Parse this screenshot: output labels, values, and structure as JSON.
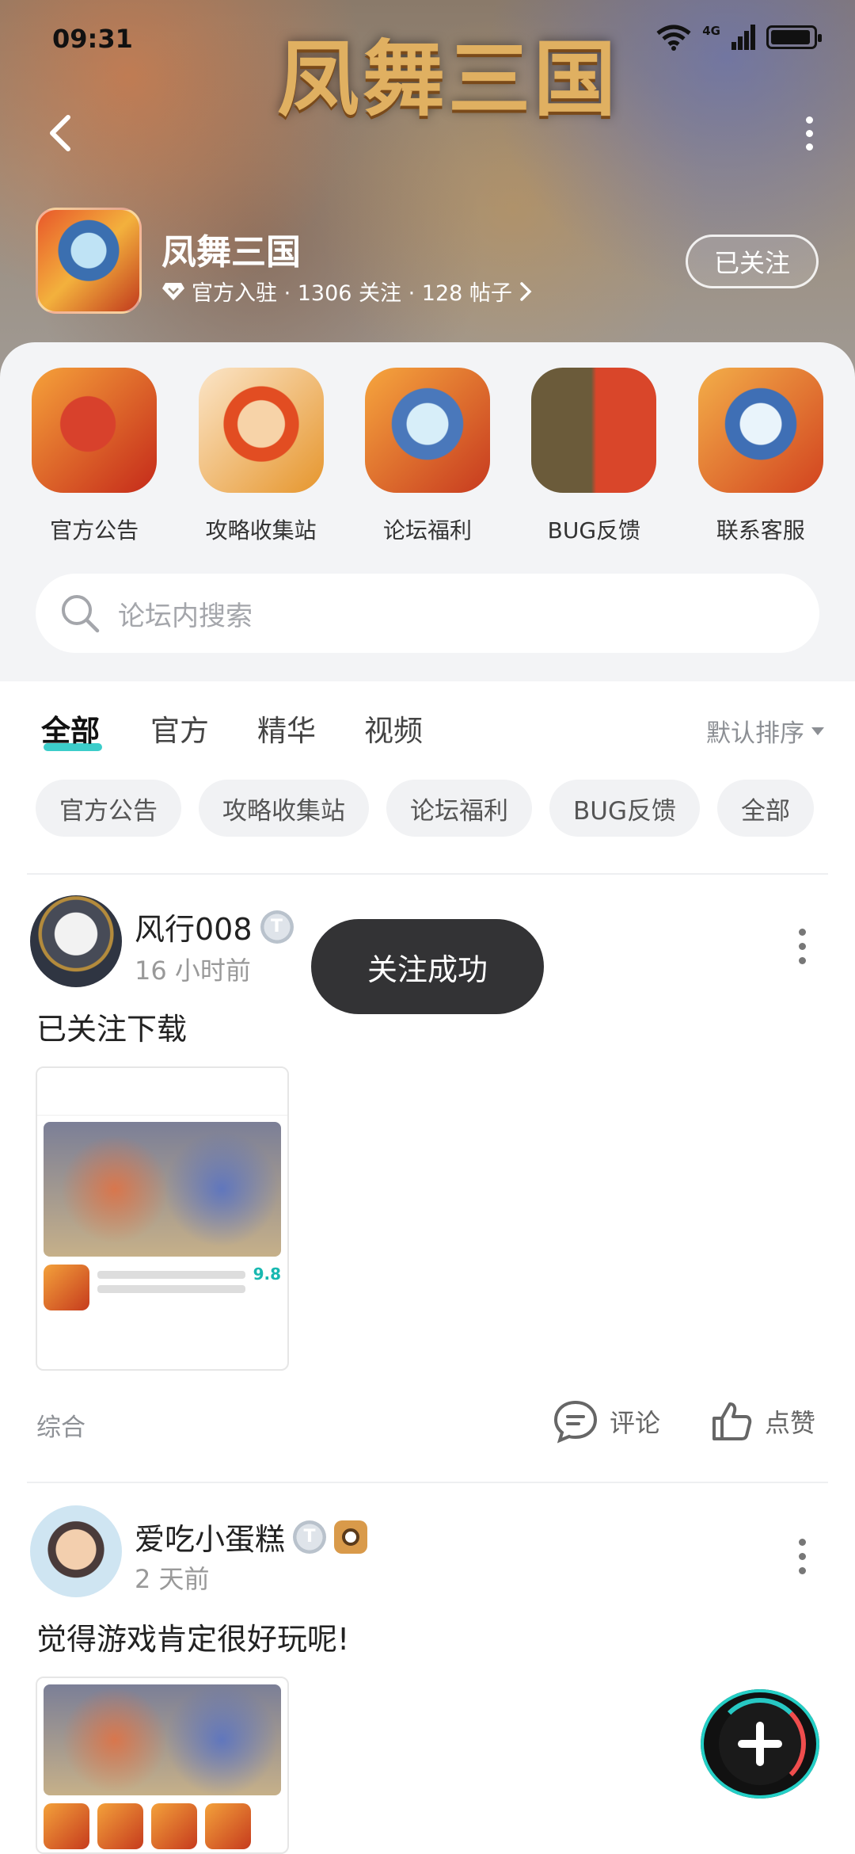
{
  "status_bar": {
    "time": "09:31",
    "network": "4G",
    "battery_level": 0.95
  },
  "header": {
    "banner_art_text": "凤舞三国",
    "game_name": "凤舞三国",
    "verified_label": "官方入驻",
    "meta_text": "官方入驻 · 1306 关注 · 128 帖子",
    "follow_button": "已关注",
    "icons": {
      "back": "back-arrow-icon",
      "more": "more-vertical-icon",
      "verified": "diamond-icon"
    }
  },
  "shortcuts": [
    {
      "label": "官方公告"
    },
    {
      "label": "攻略收集站"
    },
    {
      "label": "论坛福利"
    },
    {
      "label": "BUG反馈"
    },
    {
      "label": "联系客服"
    }
  ],
  "search": {
    "placeholder": "论坛内搜索",
    "icon": "search-icon"
  },
  "tabs": [
    {
      "label": "全部",
      "active": true
    },
    {
      "label": "官方",
      "active": false
    },
    {
      "label": "精华",
      "active": false
    },
    {
      "label": "视频",
      "active": false
    }
  ],
  "sort": {
    "label": "默认排序"
  },
  "chips": [
    "官方公告",
    "攻略收集站",
    "论坛福利",
    "BUG反馈",
    "全部"
  ],
  "toast": "关注成功",
  "posts": [
    {
      "author": "风行008",
      "level_badge": "T",
      "time": "16 小时前",
      "text": "已关注下载",
      "thumb_score": "9.8",
      "category": "综合",
      "comment_label": "评论",
      "like_label": "点赞"
    },
    {
      "author": "爱吃小蛋糕",
      "level_badge": "T",
      "time": "2 天前",
      "text": "觉得游戏肯定很好玩呢!"
    }
  ],
  "fab": {
    "icon": "plus-icon"
  },
  "colors": {
    "accent": "#27c8c4",
    "toast_bg": "#333335",
    "chip_bg": "#f1f2f4"
  }
}
